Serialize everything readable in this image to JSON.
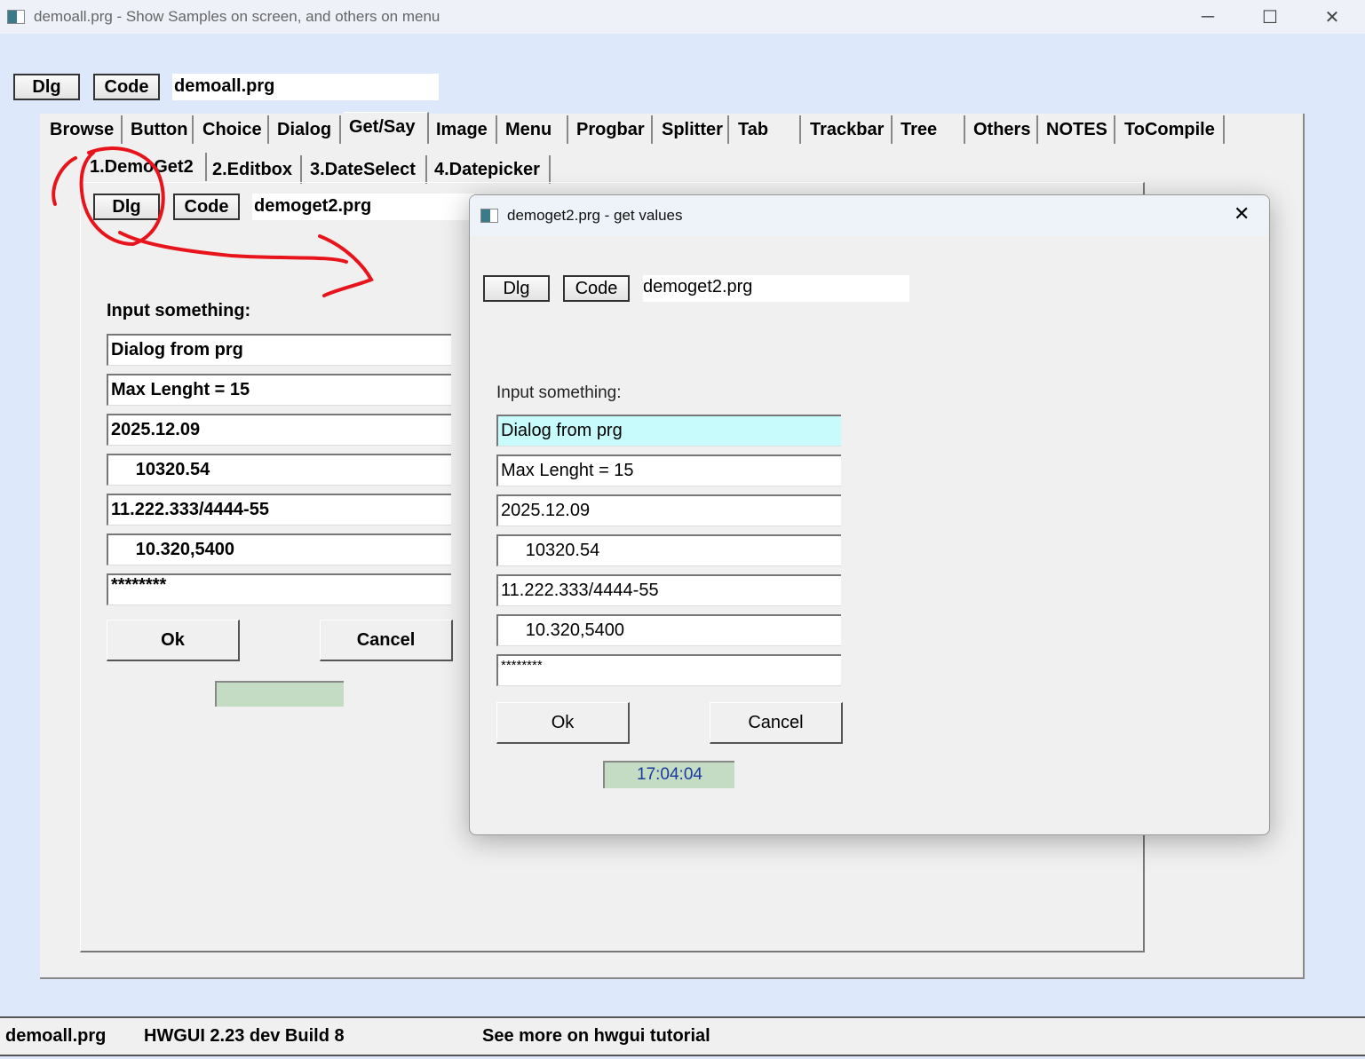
{
  "window": {
    "title": "demoall.prg - Show Samples on screen, and others on menu",
    "minimize": "─",
    "maximize": "☐",
    "close": "✕"
  },
  "top": {
    "dlg": "Dlg",
    "code": "Code",
    "file": "demoall.prg"
  },
  "tabs": [
    "Browse",
    "Button",
    "Choice",
    "Dialog",
    "Get/Say",
    "Image",
    "Menu",
    "Progbar",
    "Splitter",
    "Tab",
    "Trackbar",
    "Tree",
    "Others",
    "NOTES",
    "ToCompile"
  ],
  "active_tab": "Get/Say",
  "subtabs": [
    "1.DemoGet2",
    "2.Editbox",
    "3.DateSelect",
    "4.Datepicker"
  ],
  "page": {
    "dlg": "Dlg",
    "code": "Code",
    "file": "demoget2.prg",
    "label": "Input something:",
    "fields": [
      "Dialog from prg",
      "Max Lenght = 15",
      "2025.12.09",
      "     10320.54",
      "11.222.333/4444-55",
      "     10.320,5400",
      "********"
    ],
    "ok": "Ok",
    "cancel": "Cancel",
    "clock": ""
  },
  "dialog": {
    "title": "demoget2.prg - get values",
    "close": "✕",
    "dlg": "Dlg",
    "code": "Code",
    "file": "demoget2.prg",
    "label": "Input something:",
    "fields": [
      "Dialog from prg",
      "Max Lenght = 15",
      "2025.12.09",
      "     10320.54",
      "11.222.333/4444-55",
      "     10.320,5400",
      "********"
    ],
    "ok": "Ok",
    "cancel": "Cancel",
    "clock": "17:04:04",
    "focus_color": "#c8fcfc"
  },
  "status": {
    "file": "demoall.prg",
    "version": "HWGUI 2.23 dev Build 8",
    "hint": "See more on hwgui tutorial"
  },
  "annotation_color": "#e8141c"
}
